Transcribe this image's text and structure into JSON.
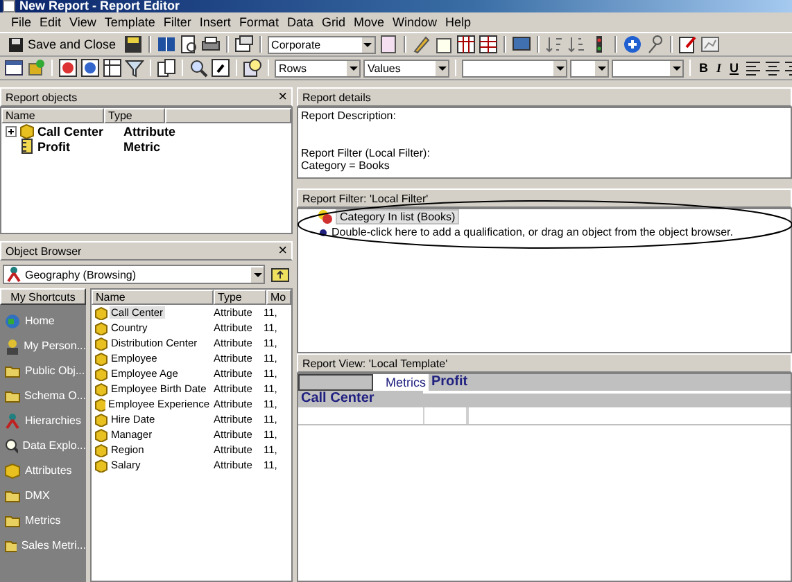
{
  "window": {
    "title": "New Report - Report Editor"
  },
  "menu": [
    "File",
    "Edit",
    "View",
    "Template",
    "Filter",
    "Insert",
    "Format",
    "Data",
    "Grid",
    "Move",
    "Window",
    "Help"
  ],
  "toolbar": {
    "save_button": "Save and Close",
    "template_combo": "Corporate",
    "rows_combo": "Rows",
    "values_combo": "Values",
    "format_buttons": [
      "B",
      "I",
      "U"
    ]
  },
  "report_objects": {
    "title": "Report objects",
    "close": "×",
    "columns": [
      "Name",
      "Type"
    ],
    "rows": [
      {
        "name": "Call Center",
        "type": "Attribute",
        "kind": "attribute",
        "expandable": true
      },
      {
        "name": "Profit",
        "type": "Metric",
        "kind": "metric",
        "expandable": false
      }
    ]
  },
  "object_browser": {
    "title": "Object Browser",
    "close": "×",
    "location": "Geography (Browsing)",
    "shortcuts_title": "My Shortcuts",
    "shortcuts": [
      "Home",
      "My Person...",
      "Public Obj...",
      "Schema O...",
      "Hierarchies",
      "Data Explo...",
      "Attributes",
      "DMX",
      "Metrics",
      "Sales Metri..."
    ],
    "columns": [
      "Name",
      "Type",
      "Mo"
    ],
    "rows": [
      {
        "name": "Call Center",
        "type": "Attribute",
        "column_3": "11,",
        "selected": true
      },
      {
        "name": "Country",
        "type": "Attribute",
        "column_3": "11,",
        "selected": false
      },
      {
        "name": "Distribution Center",
        "type": "Attribute",
        "column_3": "11,",
        "selected": false
      },
      {
        "name": "Employee",
        "type": "Attribute",
        "column_3": "11,",
        "selected": false
      },
      {
        "name": "Employee Age",
        "type": "Attribute",
        "column_3": "11,",
        "selected": false
      },
      {
        "name": "Employee Birth Date",
        "type": "Attribute",
        "column_3": "11,",
        "selected": false
      },
      {
        "name": "Employee Experience",
        "type": "Attribute",
        "column_3": "11,",
        "selected": false
      },
      {
        "name": "Hire Date",
        "type": "Attribute",
        "column_3": "11,",
        "selected": false
      },
      {
        "name": "Manager",
        "type": "Attribute",
        "column_3": "11,",
        "selected": false
      },
      {
        "name": "Region",
        "type": "Attribute",
        "column_3": "11,",
        "selected": false
      },
      {
        "name": "Salary",
        "type": "Attribute",
        "column_3": "11,",
        "selected": false
      }
    ]
  },
  "report_details": {
    "title": "Report details",
    "description_label": "Report Description:",
    "filter_label": "Report Filter (Local Filter):",
    "filter_value": "Category = Books"
  },
  "report_filter": {
    "title": "Report Filter: 'Local Filter'",
    "condition": "Category In list (Books)",
    "hint": "Double-click here to add a qualification, or drag an object from the object browser."
  },
  "report_view": {
    "title": "Report View: 'Local Template'",
    "metrics_label": "Metrics",
    "metric": "Profit",
    "row_attribute": "Call Center"
  }
}
